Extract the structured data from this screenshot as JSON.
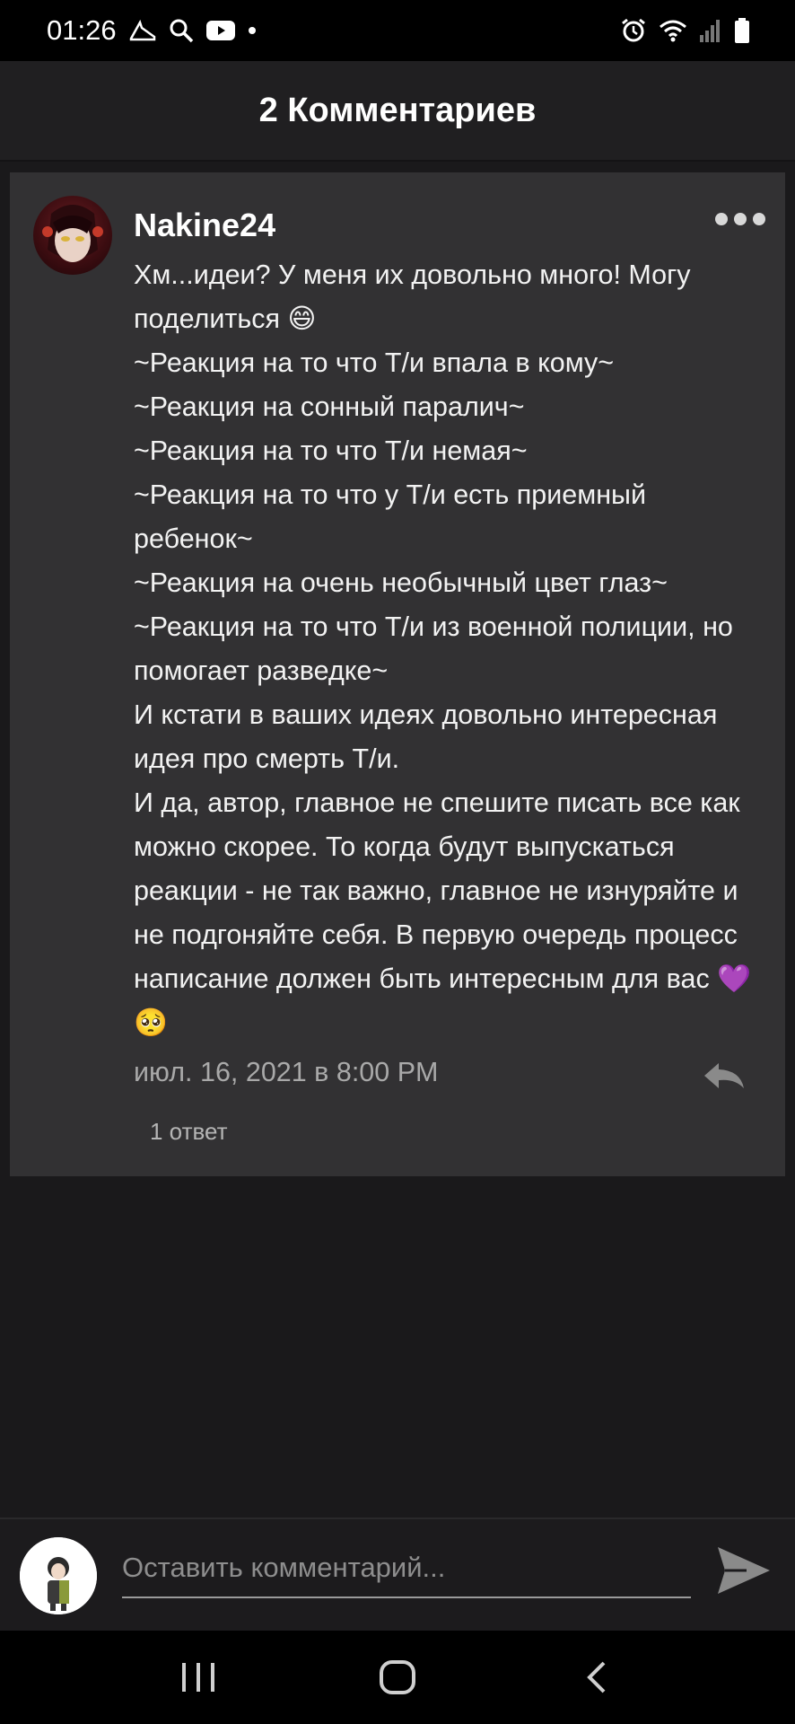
{
  "status_bar": {
    "time": "01:26",
    "icons": [
      "sneaker-icon",
      "search-icon",
      "youtube-icon",
      "dot-icon",
      "alarm-icon",
      "wifi-icon",
      "signal-icon",
      "battery-icon"
    ]
  },
  "header": {
    "title": "2 Комментариев"
  },
  "comment": {
    "author": "Nakine24",
    "text": "Хм...идеи? У меня их довольно много! Могу поделиться 😄\n~Реакция на то что Т/и впала в кому~\n~Реакция на сонный паралич~\n~Реакция на то что Т/и немая~\n~Реакция на то что у Т/и есть приемный ребенок~\n~Реакция на очень необычный цвет глаз~\n~Реакция на то что Т/и из военной полиции, но помогает разведке~\nИ кстати в ваших идеях довольно интересная идея про смерть Т/и.\nИ да, автор, главное не спешите  писать все как можно скорее. То когда будут выпускаться реакции - не так важно, главное не изнуряйте и не подгоняйте себя. В первую очередь процесс написание должен быть интересным для вас 💜🥺",
    "timestamp": "июл. 16, 2021 в 8:00 PM",
    "replies_label": "1 ответ"
  },
  "composer": {
    "placeholder": "Оставить комментарий..."
  },
  "colors": {
    "background": "#1a191b",
    "card": "#323133",
    "header": "#201f21",
    "muted_text": "#a9a9a9"
  }
}
